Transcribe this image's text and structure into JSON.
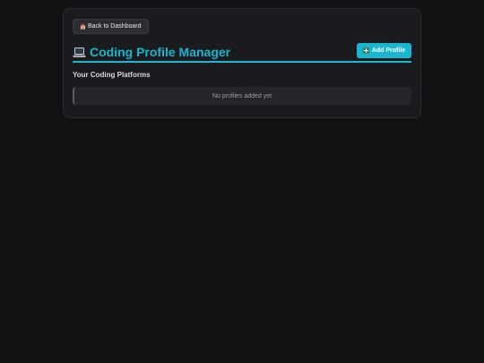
{
  "back_button": {
    "label": "Back to Dashboard",
    "icon": "home-icon"
  },
  "header": {
    "title": "Coding Profile Manager",
    "title_icon": "laptop-icon",
    "accent_color": "#19b6cf"
  },
  "add_button": {
    "label": "Add Profile",
    "icon": "plus-icon"
  },
  "section": {
    "title": "Your Coding Platforms",
    "empty_message": "No profiles added yet."
  }
}
